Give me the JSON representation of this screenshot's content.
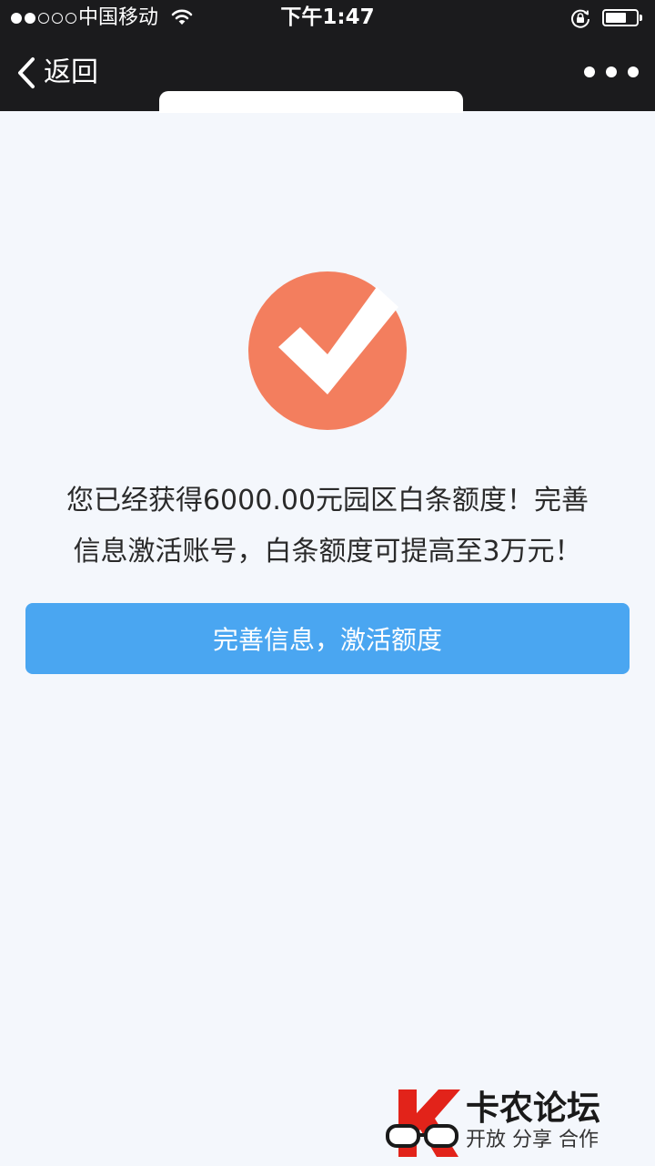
{
  "status_bar": {
    "carrier": "中国移动",
    "time": "下午1:47",
    "signal_bars": 2,
    "signal_total": 5,
    "battery_level": 0.7
  },
  "nav": {
    "back_label": "返回",
    "back_icon": "chevron-left-icon",
    "more_icon": "more-dots-icon"
  },
  "main": {
    "success_icon": "check-circle-icon",
    "success_color": "#f37e5e",
    "message_line1": "您已经获得6000.00元园区白条额度！完善",
    "message_line2": "信息激活账号，白条额度可提高至3万元！",
    "button_label": "完善信息，激活额度",
    "button_color": "#4aa6f1"
  },
  "watermark": {
    "title": "卡农论坛",
    "slogan": "开放 分享 合作",
    "logo_color": "#e2231a"
  }
}
